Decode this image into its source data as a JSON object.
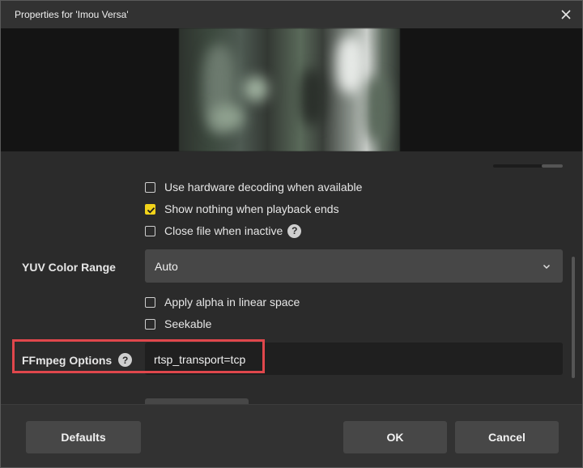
{
  "window": {
    "title": "Properties for 'Imou Versa'"
  },
  "settings": {
    "checkboxes_top": [
      {
        "label": "Use hardware decoding when available",
        "checked": false
      },
      {
        "label": "Show nothing when playback ends",
        "checked": true
      },
      {
        "label": "Close file when inactive",
        "checked": false,
        "has_help": true
      }
    ],
    "yuv": {
      "label": "YUV Color Range",
      "value": "Auto"
    },
    "checkboxes_mid": [
      {
        "label": "Apply alpha in linear space",
        "checked": false
      },
      {
        "label": "Seekable",
        "checked": false
      }
    ],
    "ffmpeg": {
      "label": "FFmpeg Options",
      "value": "rtsp_transport=tcp"
    }
  },
  "footer": {
    "defaults_label": "Defaults",
    "ok_label": "OK",
    "cancel_label": "Cancel"
  },
  "colors": {
    "accent_check": "#f2d31a",
    "highlight_box": "#e0474c"
  },
  "icons": {
    "close": "close-icon",
    "help": "help-icon",
    "dropdown": "chevron-down-icon",
    "check": "check-icon"
  }
}
